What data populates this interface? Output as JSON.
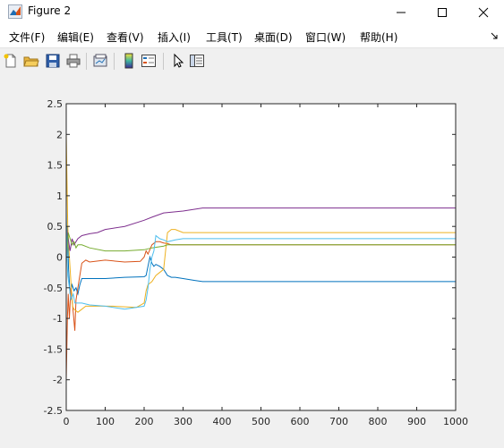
{
  "window": {
    "title": "Figure 2"
  },
  "menus": [
    {
      "label": "文件(F)"
    },
    {
      "label": "编辑(E)"
    },
    {
      "label": "查看(V)"
    },
    {
      "label": "插入(I)"
    },
    {
      "label": "工具(T)"
    },
    {
      "label": "桌面(D)"
    },
    {
      "label": "窗口(W)"
    },
    {
      "label": "帮助(H)"
    }
  ],
  "menu_overflow_icon": "small-arrow-icon",
  "toolbar": [
    {
      "icon": "new-figure-icon"
    },
    {
      "icon": "open-file-icon"
    },
    {
      "icon": "save-icon"
    },
    {
      "icon": "print-icon"
    },
    {
      "icon": "link-plot-icon"
    },
    {
      "icon": "insert-colorbar-icon"
    },
    {
      "icon": "insert-legend-icon"
    },
    {
      "icon": "pointer-icon"
    },
    {
      "icon": "property-editor-icon"
    }
  ],
  "colors": {
    "series1": "#0072BD",
    "series2": "#D95319",
    "series3": "#EDB120",
    "series4": "#7E2F8E",
    "series5": "#77AC30",
    "series6": "#4DBEEE"
  },
  "chart_data": {
    "type": "line",
    "title": "",
    "xlabel": "",
    "ylabel": "",
    "xlim": [
      0,
      1000
    ],
    "ylim": [
      -2.5,
      2.5
    ],
    "xticks": [
      0,
      100,
      200,
      300,
      400,
      500,
      600,
      700,
      800,
      900,
      1000
    ],
    "yticks": [
      -2.5,
      -2,
      -1.5,
      -1,
      -0.5,
      0,
      0.5,
      1,
      1.5,
      2,
      2.5
    ],
    "xtick_labels": [
      "0",
      "100",
      "200",
      "300",
      "400",
      "500",
      "600",
      "700",
      "800",
      "900",
      "1000"
    ],
    "ytick_labels": [
      "-2.5",
      "-2",
      "-1.5",
      "-1",
      "-0.5",
      "0",
      "0.5",
      "1",
      "1.5",
      "2",
      "2.5"
    ],
    "grid": false,
    "series": [
      {
        "color": "#0072BD",
        "x": [
          0,
          3,
          6,
          10,
          15,
          20,
          25,
          30,
          35,
          40,
          60,
          100,
          150,
          200,
          205,
          210,
          215,
          220,
          225,
          230,
          240,
          250,
          260,
          270,
          280,
          300,
          330,
          350,
          400,
          500,
          1000
        ],
        "y": [
          0,
          0.5,
          -0.2,
          -0.6,
          -0.45,
          -0.55,
          -0.5,
          -0.6,
          -0.45,
          -0.35,
          -0.35,
          -0.35,
          -0.33,
          -0.32,
          -0.3,
          -0.15,
          0,
          -0.1,
          -0.15,
          -0.12,
          -0.15,
          -0.2,
          -0.3,
          -0.33,
          -0.33,
          -0.35,
          -0.38,
          -0.4,
          -0.4,
          -0.4,
          -0.4
        ]
      },
      {
        "color": "#D95319",
        "x": [
          0,
          3,
          5,
          8,
          12,
          18,
          22,
          25,
          30,
          35,
          40,
          50,
          60,
          100,
          150,
          190,
          200,
          205,
          210,
          220,
          230,
          240,
          250,
          260,
          270,
          300,
          400,
          500,
          1000
        ],
        "y": [
          -2.0,
          -1.0,
          -0.6,
          -1.0,
          -0.5,
          -0.9,
          -1.2,
          -0.7,
          -0.5,
          -0.3,
          -0.1,
          -0.05,
          -0.08,
          -0.05,
          -0.08,
          -0.07,
          0.0,
          0.1,
          0.05,
          0.2,
          0.25,
          0.25,
          0.23,
          0.22,
          0.2,
          0.2,
          0.2,
          0.2,
          0.2
        ]
      },
      {
        "color": "#EDB120",
        "x": [
          0,
          2,
          4,
          8,
          12,
          16,
          20,
          30,
          40,
          50,
          80,
          120,
          180,
          200,
          205,
          210,
          220,
          230,
          240,
          250,
          260,
          270,
          280,
          300,
          350,
          400,
          500,
          1000
        ],
        "y": [
          2.0,
          1.2,
          0.5,
          0.0,
          -0.4,
          -0.8,
          -0.85,
          -0.9,
          -0.85,
          -0.8,
          -0.8,
          -0.8,
          -0.82,
          -0.75,
          -0.55,
          -0.45,
          -0.4,
          -0.3,
          -0.25,
          -0.2,
          0.4,
          0.45,
          0.45,
          0.4,
          0.4,
          0.4,
          0.4,
          0.4
        ]
      },
      {
        "color": "#7E2F8E",
        "x": [
          0,
          5,
          10,
          15,
          20,
          30,
          40,
          60,
          80,
          100,
          150,
          200,
          220,
          250,
          300,
          350,
          400,
          500,
          1000
        ],
        "y": [
          0.5,
          0.3,
          0.1,
          0.3,
          0.2,
          0.3,
          0.35,
          0.38,
          0.4,
          0.45,
          0.5,
          0.6,
          0.65,
          0.72,
          0.75,
          0.8,
          0.8,
          0.8,
          0.8
        ]
      },
      {
        "color": "#77AC30",
        "x": [
          0,
          2,
          5,
          10,
          15,
          20,
          25,
          30,
          40,
          60,
          100,
          150,
          200,
          220,
          250,
          260,
          300,
          400,
          500,
          1000
        ],
        "y": [
          0.6,
          0.0,
          0.4,
          0.3,
          0.2,
          0.25,
          0.15,
          0.2,
          0.2,
          0.15,
          0.1,
          0.1,
          0.12,
          0.15,
          0.18,
          0.2,
          0.2,
          0.2,
          0.2,
          0.2
        ]
      },
      {
        "color": "#4DBEEE",
        "x": [
          0,
          2,
          4,
          8,
          12,
          18,
          22,
          30,
          40,
          60,
          100,
          150,
          200,
          205,
          210,
          215,
          220,
          225,
          230,
          240,
          250,
          260,
          280,
          300,
          400,
          500,
          1000
        ],
        "y": [
          0.8,
          0.0,
          -0.3,
          -0.5,
          -0.7,
          -0.6,
          -0.75,
          -0.75,
          -0.75,
          -0.78,
          -0.8,
          -0.85,
          -0.8,
          -0.7,
          -0.5,
          -0.2,
          0.0,
          0.1,
          0.35,
          0.3,
          0.28,
          0.25,
          0.28,
          0.3,
          0.3,
          0.3,
          0.3
        ]
      }
    ]
  }
}
